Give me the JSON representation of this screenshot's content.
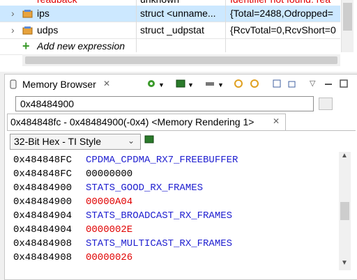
{
  "expressions": {
    "rows": [
      {
        "name": "readback",
        "type": "unknown",
        "value": "Identifier not found: rea",
        "value_red": true,
        "expanded": false
      },
      {
        "name": "ips",
        "type": "struct <unname...",
        "value": "{Total=2488,Odropped=",
        "value_red": false,
        "expanded": false
      },
      {
        "name": "udps",
        "type": "struct _udpstat",
        "value": "{RcvTotal=0,RcvShort=0",
        "value_red": false,
        "expanded": false
      }
    ],
    "add_new": "Add new expression"
  },
  "memory_browser": {
    "tab_title": "Memory Browser",
    "close_glyph": "✕",
    "address_value": "0x48484900",
    "rendering_tab": "0x484848fc - 0x48484900(-0x4) <Memory Rendering 1>",
    "rendering_close": "✕",
    "format_selected": "32-Bit Hex - TI Style",
    "rows": [
      {
        "addr": "0x484848FC",
        "text": "CPDMA_CPDMA_RX7_FREEBUFFER",
        "kind": "symbol"
      },
      {
        "addr": "0x484848FC",
        "text": "00000000",
        "kind": "value"
      },
      {
        "addr": "0x48484900",
        "text": "STATS_GOOD_RX_FRAMES",
        "kind": "symbol"
      },
      {
        "addr": "0x48484900",
        "text": "00000A04",
        "kind": "changed"
      },
      {
        "addr": "0x48484904",
        "text": "STATS_BROADCAST_RX_FRAMES",
        "kind": "symbol"
      },
      {
        "addr": "0x48484904",
        "text": "0000002E",
        "kind": "changed"
      },
      {
        "addr": "0x48484908",
        "text": "STATS_MULTICAST_RX_FRAMES",
        "kind": "symbol"
      },
      {
        "addr": "0x48484908",
        "text": "00000026",
        "kind": "changed"
      }
    ]
  },
  "colors": {
    "symbol": "#2020d0",
    "changed": "#e00000",
    "selection": "#cce8ff"
  },
  "icons": [
    "chevron-right-icon",
    "struct-icon",
    "add-plus-icon",
    "memory-chip-icon",
    "dropdown-arrow-icon",
    "sync-icon",
    "new-view-icon",
    "minimize-icon",
    "maximize-icon",
    "copy-icon",
    "scroll-up-icon",
    "scroll-down-icon"
  ]
}
